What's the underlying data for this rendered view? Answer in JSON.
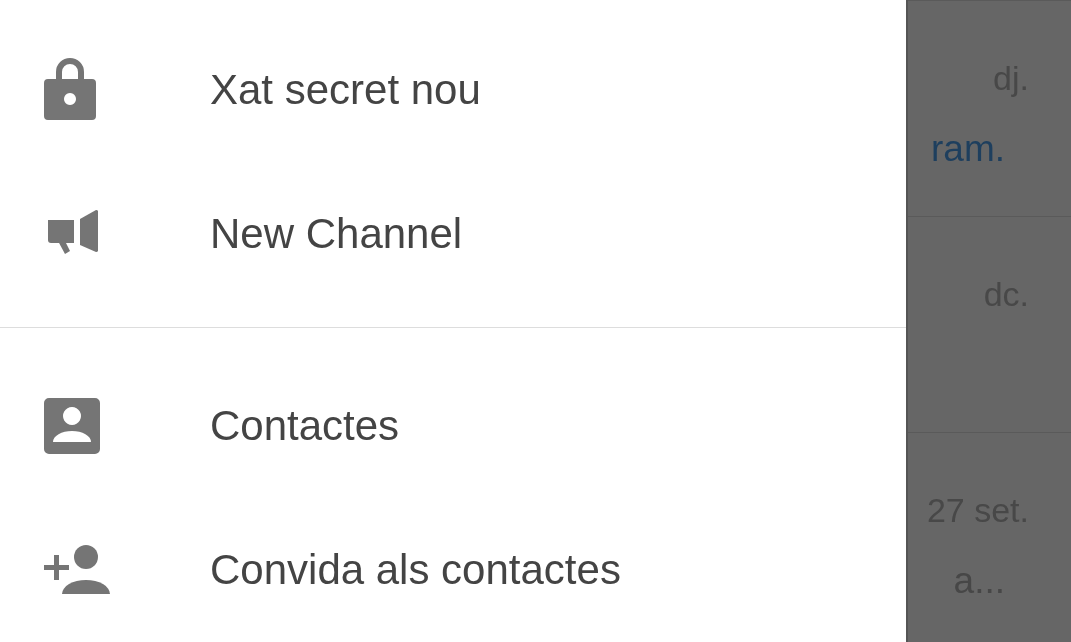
{
  "drawer": {
    "groups": [
      {
        "items": [
          {
            "kind": "lock",
            "label": "Xat secret nou"
          },
          {
            "kind": "megaphone",
            "label": "New Channel"
          }
        ]
      },
      {
        "items": [
          {
            "kind": "contact",
            "label": "Contactes"
          },
          {
            "kind": "person-add",
            "label": "Convida als contactes"
          }
        ]
      }
    ]
  },
  "chat_list": {
    "rows": [
      {
        "time": "dj.",
        "preview": "ram.",
        "color": "#1e3f5e"
      },
      {
        "time": "dc."
      },
      {
        "time": "27 set.",
        "preview": "a...",
        "color": "#474747"
      }
    ]
  }
}
